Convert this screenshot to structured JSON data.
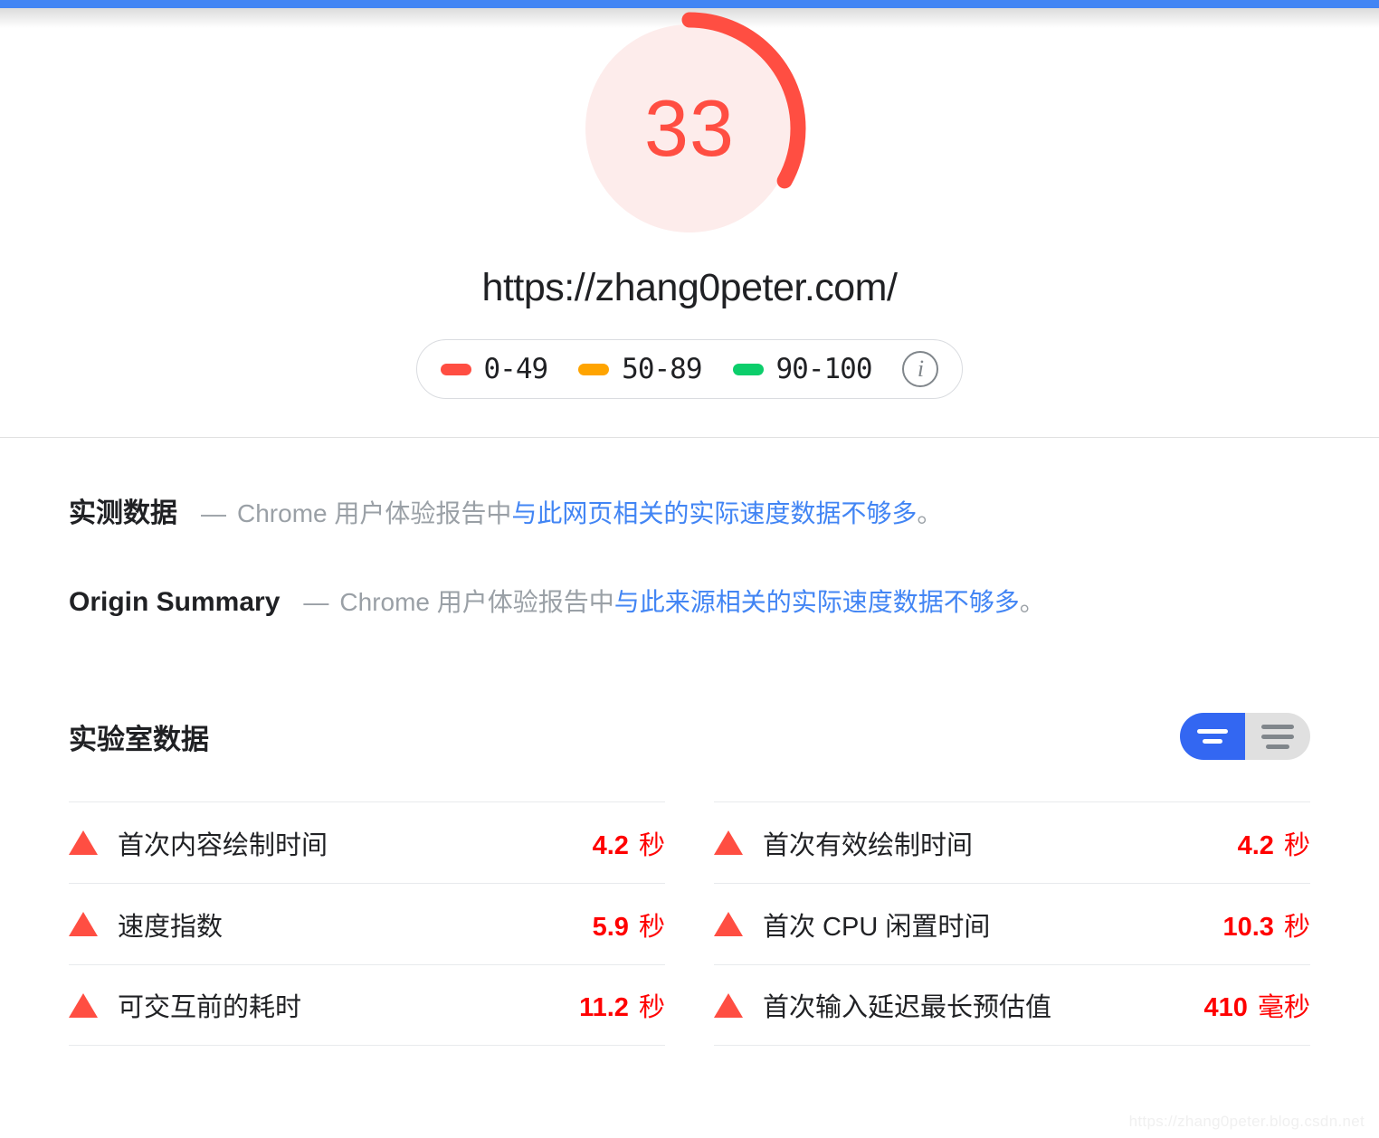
{
  "progress_bar": {
    "color": "#4285f4"
  },
  "score": {
    "value": "33",
    "color": "#ff4e42",
    "track_color": "#fdeceb",
    "percent": 33
  },
  "page_url": "https://zhang0peter.com/",
  "legend": {
    "items": [
      {
        "range": "0-49",
        "color": "#ff4e42"
      },
      {
        "range": "50-89",
        "color": "#ffa400"
      },
      {
        "range": "90-100",
        "color": "#0cce6b"
      }
    ],
    "info_icon": "info-icon",
    "info_glyph": "i"
  },
  "field_data": {
    "blocks": [
      {
        "title": "实测数据",
        "dash": "—",
        "prefix": "Chrome 用户体验报告中",
        "link": "与此网页相关的实际速度数据不够多",
        "suffix": "。"
      },
      {
        "title": "Origin Summary",
        "dash": "—",
        "prefix": "Chrome 用户体验报告中",
        "link": "与此来源相关的实际速度数据不够多",
        "suffix": "。"
      }
    ]
  },
  "lab_data": {
    "title": "实验室数据",
    "toggle": {
      "active": "compact-view",
      "options": [
        "compact-view",
        "list-view"
      ]
    },
    "left_column": [
      {
        "status": "fail",
        "name": "首次内容绘制时间",
        "value": "4.2",
        "unit": "秒"
      },
      {
        "status": "fail",
        "name": "速度指数",
        "value": "5.9",
        "unit": "秒"
      },
      {
        "status": "fail",
        "name": "可交互前的耗时",
        "value": "11.2",
        "unit": "秒"
      }
    ],
    "right_column": [
      {
        "status": "fail",
        "name": "首次有效绘制时间",
        "value": "4.2",
        "unit": "秒"
      },
      {
        "status": "fail",
        "name": "首次 CPU 闲置时间",
        "value": "10.3",
        "unit": "秒"
      },
      {
        "status": "fail",
        "name": "首次输入延迟最长预估值",
        "value": "410",
        "unit": "毫秒"
      }
    ]
  },
  "watermark": "https://zhang0peter.blog.csdn.net"
}
